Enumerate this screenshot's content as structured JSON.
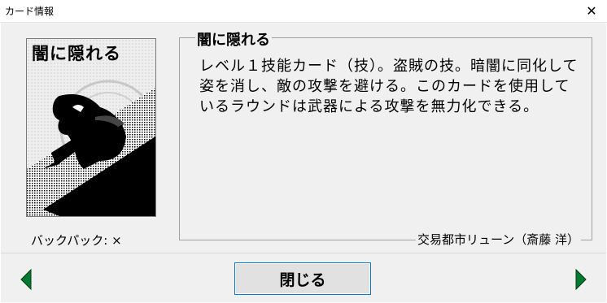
{
  "window": {
    "title": "カード情報",
    "close_glyph": "✕"
  },
  "card": {
    "image_title": "闇に隠れる",
    "name": "闇に隠れる",
    "description": "レベル１技能カード（技）。盗賊の技。暗闇に同化して姿を消し、敵の攻撃を避ける。このカードを使用しているラウンドは武器による攻撃を無力化できる。",
    "backpack": "バックパック: ×",
    "credit": "交易都市リューン（斎藤 洋）"
  },
  "footer": {
    "close_label": "閉じる"
  },
  "icons": {
    "prev": "arrow-left-icon",
    "next": "arrow-right-icon",
    "accent": "#007a2e",
    "focus": "#0078d7"
  }
}
